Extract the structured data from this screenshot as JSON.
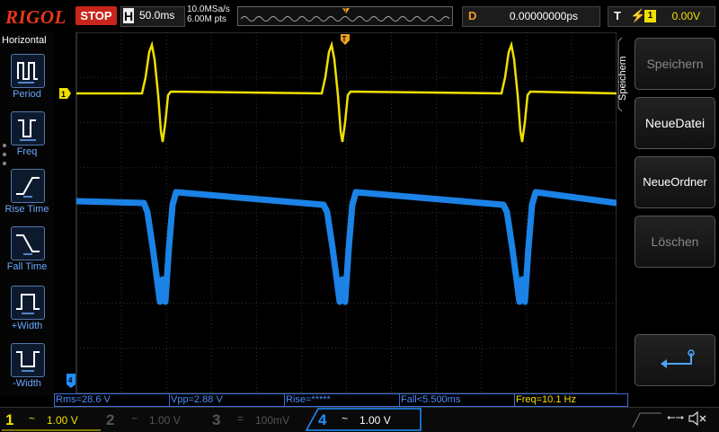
{
  "header": {
    "brand": "RIGOL",
    "run_state": "STOP",
    "timebase_label": "H",
    "timebase_value": "50.0ms",
    "sample_rate": "10.0MSa/s",
    "memory_depth": "6.00M pts",
    "delay_label": "D",
    "delay_value": "0.00000000ps",
    "trigger_label": "T",
    "trigger_source": "1",
    "trigger_level": "0.00V"
  },
  "left_panel": {
    "title": "Horizontal",
    "items": [
      {
        "label": "Period",
        "icon": "period-icon"
      },
      {
        "label": "Freq",
        "icon": "freq-icon"
      },
      {
        "label": "Rise Time",
        "icon": "rise-time-icon"
      },
      {
        "label": "Fall Time",
        "icon": "fall-time-icon"
      },
      {
        "label": "+Width",
        "icon": "pos-width-icon"
      },
      {
        "label": "-Width",
        "icon": "neg-width-icon"
      }
    ]
  },
  "right_panel": {
    "title": "Speichern",
    "buttons": [
      {
        "label": "Speichern",
        "enabled": false
      },
      {
        "label": "NeueDatei",
        "enabled": true
      },
      {
        "label": "NeueOrdner",
        "enabled": true
      },
      {
        "label": "Löschen",
        "enabled": false
      }
    ],
    "return_icon": "return-arrow-icon"
  },
  "measurements": [
    {
      "text": "Rms=28.6 V",
      "color": "#4d8dff"
    },
    {
      "text": "Vpp=2.88 V",
      "color": "#4d8dff"
    },
    {
      "text": "Rise=*****",
      "color": "#4d8dff"
    },
    {
      "text": "Fall<5.500ms",
      "color": "#4d8dff"
    },
    {
      "text": "Freq=10.1 Hz",
      "color": "#f0e000"
    }
  ],
  "channels": [
    {
      "num": "1",
      "coupling": "~",
      "scale": "1.00 V",
      "color": "#f0e000",
      "active": true
    },
    {
      "num": "2",
      "coupling": "~",
      "scale": "1.00 V",
      "color": "#555555",
      "active": false
    },
    {
      "num": "3",
      "coupling": "=",
      "scale": "100mV",
      "color": "#555555",
      "active": false
    },
    {
      "num": "4",
      "coupling": "~",
      "scale": "1.00 V",
      "color": "#1e90ff",
      "active": true
    }
  ],
  "markers": {
    "ch1_marker": "1",
    "trigger_pos_marker": "T",
    "ch4_ground_marker": "4"
  },
  "status_icons": [
    "usb-icon",
    "speaker-muted-icon"
  ],
  "colors": {
    "ch1": "#f0e000",
    "ch4": "#1e90ff",
    "accent_orange": "#f0a020",
    "stop_red": "#c8261c"
  }
}
